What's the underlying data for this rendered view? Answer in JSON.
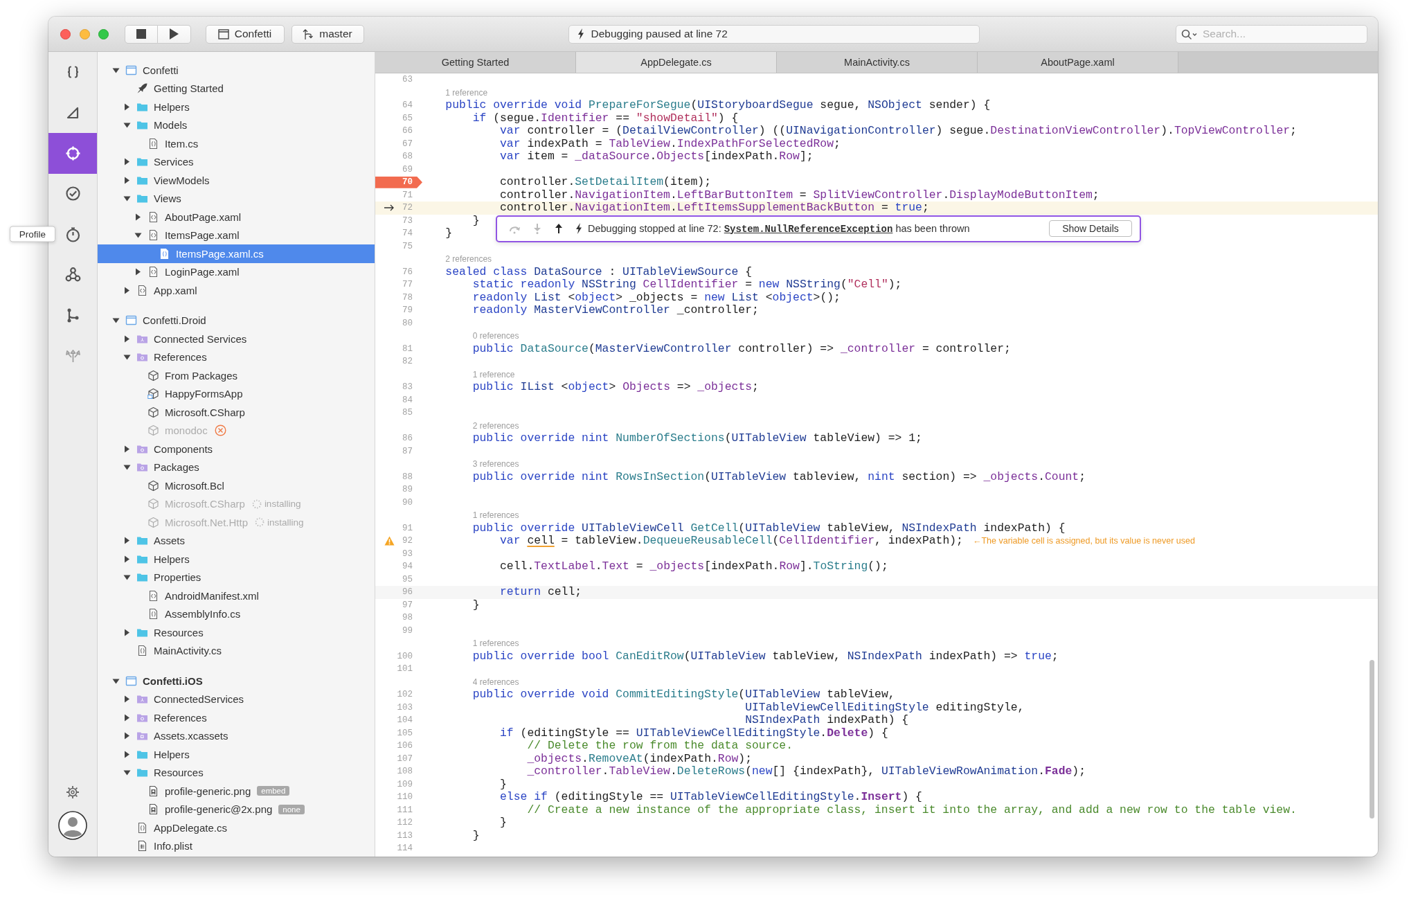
{
  "toolbar": {
    "scheme": "Confetti",
    "branch": "master",
    "status": "Debugging paused at line 72",
    "search": {
      "placeholder": "Search..."
    }
  },
  "activity_bar": {
    "items": [
      {
        "kind": "code",
        "selected": false,
        "disabled": false
      },
      {
        "kind": "design",
        "selected": false,
        "disabled": false
      },
      {
        "kind": "debug",
        "selected": true,
        "disabled": false
      },
      {
        "kind": "test",
        "selected": false,
        "disabled": false
      },
      {
        "kind": "profile",
        "selected": false,
        "disabled": false,
        "tooltip": "Profile"
      },
      {
        "kind": "graph",
        "selected": false,
        "disabled": false
      },
      {
        "kind": "branch",
        "selected": false,
        "disabled": false
      },
      {
        "kind": "deploy",
        "selected": false,
        "disabled": true
      }
    ]
  },
  "tree": [
    {
      "label": "Confetti",
      "kind": "project",
      "expanded": true,
      "selected": false,
      "children": [
        {
          "label": "Getting Started",
          "kind": "rocket",
          "selected": false
        },
        {
          "label": "Helpers",
          "kind": "folder",
          "expanded": false,
          "selected": false
        },
        {
          "label": "Models",
          "kind": "folder",
          "expanded": true,
          "selected": false,
          "children": [
            {
              "label": "Item.cs",
              "kind": "cs",
              "selected": false
            }
          ]
        },
        {
          "label": "Services",
          "kind": "folder",
          "expanded": false,
          "selected": false
        },
        {
          "label": "ViewModels",
          "kind": "folder",
          "expanded": false,
          "selected": false
        },
        {
          "label": "Views",
          "kind": "folder",
          "expanded": true,
          "selected": false,
          "children": [
            {
              "label": "AboutPage.xaml",
              "kind": "xaml",
              "expanded": false,
              "selected": false
            },
            {
              "label": "ItemsPage.xaml",
              "kind": "xaml",
              "expanded": true,
              "selected": false,
              "children": [
                {
                  "label": "ItemsPage.xaml.cs",
                  "kind": "cs",
                  "selected": true
                }
              ]
            },
            {
              "label": "LoginPage.xaml",
              "kind": "xaml",
              "expanded": false,
              "selected": false
            }
          ]
        },
        {
          "label": "App.xaml",
          "kind": "xaml",
          "expanded": false,
          "selected": false
        }
      ]
    },
    {
      "label": "Confetti.Droid",
      "kind": "project",
      "expanded": true,
      "selected": false,
      "children": [
        {
          "label": "Connected Services",
          "kind": "service-folder",
          "expanded": false,
          "selected": false
        },
        {
          "label": "References",
          "kind": "ref-folder",
          "expanded": true,
          "selected": false,
          "children": [
            {
              "label": "From Packages",
              "kind": "package",
              "selected": false
            },
            {
              "label": "HappyFormsApp",
              "kind": "package-app",
              "selected": false
            },
            {
              "label": "Microsoft.CSharp",
              "kind": "package",
              "selected": false
            },
            {
              "label": "monodoc",
              "kind": "package",
              "selected": false,
              "dimmed": true,
              "error": true
            }
          ]
        },
        {
          "label": "Components",
          "kind": "ref-folder",
          "expanded": false,
          "selected": false
        },
        {
          "label": "Packages",
          "kind": "ref-folder",
          "expanded": true,
          "selected": false,
          "children": [
            {
              "label": "Microsoft.Bcl",
              "kind": "package",
              "selected": false
            },
            {
              "label": "Microsoft.CSharp",
              "kind": "package",
              "selected": false,
              "dimmed": true,
              "status": "installing"
            },
            {
              "label": "Microsoft.Net.Http",
              "kind": "package",
              "selected": false,
              "dimmed": true,
              "status": "installing"
            }
          ]
        },
        {
          "label": "Assets",
          "kind": "folder",
          "expanded": false,
          "selected": false
        },
        {
          "label": "Helpers",
          "kind": "folder",
          "expanded": false,
          "selected": false
        },
        {
          "label": "Properties",
          "kind": "folder",
          "expanded": true,
          "selected": false,
          "children": [
            {
              "label": "AndroidManifest.xml",
              "kind": "xaml",
              "selected": false
            },
            {
              "label": "AssemblyInfo.cs",
              "kind": "cs",
              "selected": false
            }
          ]
        },
        {
          "label": "Resources",
          "kind": "folder",
          "expanded": false,
          "selected": false
        },
        {
          "label": "MainActivity.cs",
          "kind": "cs",
          "selected": false
        }
      ]
    },
    {
      "label": "Confetti.iOS",
      "kind": "project",
      "expanded": true,
      "selected": false,
      "startup": true,
      "children": [
        {
          "label": "ConnectedServices",
          "kind": "service-folder",
          "expanded": false,
          "selected": false
        },
        {
          "label": "References",
          "kind": "ref-folder",
          "expanded": false,
          "selected": false
        },
        {
          "label": "Assets.xcassets",
          "kind": "asset-folder",
          "expanded": false,
          "selected": false
        },
        {
          "label": "Helpers",
          "kind": "folder",
          "expanded": false,
          "selected": false
        },
        {
          "label": "Resources",
          "kind": "folder",
          "expanded": true,
          "selected": false,
          "children": [
            {
              "label": "profile-generic.png",
              "kind": "image",
              "selected": false,
              "badge": "embed"
            },
            {
              "label": "profile-generic@2x.png",
              "kind": "image",
              "selected": false,
              "badge": "none"
            }
          ]
        },
        {
          "label": "AppDelegate.cs",
          "kind": "cs",
          "selected": false
        },
        {
          "label": "Info.plist",
          "kind": "plist",
          "selected": false
        }
      ]
    }
  ],
  "editor": {
    "tabs": [
      {
        "label": "Getting Started",
        "selected": false
      },
      {
        "label": "AppDelegate.cs",
        "selected": true
      },
      {
        "label": "MainActivity.cs",
        "selected": false
      },
      {
        "label": "AboutPage.xaml",
        "selected": false
      }
    ],
    "rows": [
      {
        "kind": "line",
        "number": "63"
      },
      {
        "kind": "ref",
        "text": "1 reference"
      },
      {
        "kind": "line",
        "number": "64",
        "code": [
          {
            "kind": "keyword",
            "text": "    public override void "
          },
          {
            "kind": "method",
            "text": "PrepareForSegue"
          },
          {
            "kind": "plain",
            "text": "("
          },
          {
            "kind": "type",
            "text": "UIStoryboardSegue"
          },
          {
            "kind": "plain",
            "text": " segue, "
          },
          {
            "kind": "type",
            "text": "NSObject"
          },
          {
            "kind": "plain",
            "text": " sender) {"
          }
        ]
      },
      {
        "kind": "line",
        "number": "65",
        "code": [
          {
            "kind": "keyword",
            "text": "        if"
          },
          {
            "kind": "plain",
            "text": " (segue."
          },
          {
            "kind": "member",
            "text": "Identifier"
          },
          {
            "kind": "plain",
            "text": " == "
          },
          {
            "kind": "string",
            "text": "\"showDetail\""
          },
          {
            "kind": "plain",
            "text": ") {"
          }
        ]
      },
      {
        "kind": "line",
        "number": "66",
        "code": [
          {
            "kind": "keyword",
            "text": "            var"
          },
          {
            "kind": "plain",
            "text": " controller = ("
          },
          {
            "kind": "type",
            "text": "DetailViewController"
          },
          {
            "kind": "plain",
            "text": ") (("
          },
          {
            "kind": "type",
            "text": "UINavigationController"
          },
          {
            "kind": "plain",
            "text": ") segue."
          },
          {
            "kind": "member",
            "text": "DestinationViewController"
          },
          {
            "kind": "plain",
            "text": ")."
          },
          {
            "kind": "member",
            "text": "TopViewController"
          },
          {
            "kind": "plain",
            "text": ";"
          }
        ]
      },
      {
        "kind": "line",
        "number": "67",
        "code": [
          {
            "kind": "keyword",
            "text": "            var"
          },
          {
            "kind": "plain",
            "text": " indexPath = "
          },
          {
            "kind": "member",
            "text": "TableView"
          },
          {
            "kind": "plain",
            "text": "."
          },
          {
            "kind": "member",
            "text": "IndexPathForSelectedRow"
          },
          {
            "kind": "plain",
            "text": ";"
          }
        ]
      },
      {
        "kind": "line",
        "number": "68",
        "code": [
          {
            "kind": "keyword",
            "text": "            var"
          },
          {
            "kind": "plain",
            "text": " item = "
          },
          {
            "kind": "member",
            "text": "_dataSource"
          },
          {
            "kind": "plain",
            "text": "."
          },
          {
            "kind": "member",
            "text": "Objects"
          },
          {
            "kind": "plain",
            "text": "[indexPath."
          },
          {
            "kind": "member",
            "text": "Row"
          },
          {
            "kind": "plain",
            "text": "];"
          }
        ]
      },
      {
        "kind": "line",
        "number": "69"
      },
      {
        "kind": "breakpoint",
        "number": "70",
        "code": [
          {
            "kind": "plain",
            "text": "            controller."
          },
          {
            "kind": "method",
            "text": "SetDetailItem"
          },
          {
            "kind": "plain",
            "text": "(item);"
          }
        ]
      },
      {
        "kind": "line",
        "number": "71",
        "code": [
          {
            "kind": "plain",
            "text": "            controller."
          },
          {
            "kind": "member",
            "text": "NavigationItem"
          },
          {
            "kind": "plain",
            "text": "."
          },
          {
            "kind": "member",
            "text": "LeftBarButtonItem"
          },
          {
            "kind": "plain",
            "text": " = "
          },
          {
            "kind": "member",
            "text": "SplitViewController"
          },
          {
            "kind": "plain",
            "text": "."
          },
          {
            "kind": "member",
            "text": "DisplayModeButtonItem"
          },
          {
            "kind": "plain",
            "text": ";"
          }
        ]
      },
      {
        "kind": "paused",
        "number": "72",
        "code": [
          {
            "kind": "plain",
            "text": "            controller."
          },
          {
            "kind": "member",
            "text": "NavigationItem"
          },
          {
            "kind": "plain",
            "text": "."
          },
          {
            "kind": "member",
            "text": "LeftItemsSupplementBackButton"
          },
          {
            "kind": "plain",
            "text": " = "
          },
          {
            "kind": "keyword",
            "text": "true"
          },
          {
            "kind": "plain",
            "text": ";"
          }
        ]
      },
      {
        "kind": "line",
        "number": "73",
        "code": [
          {
            "kind": "plain",
            "text": "        }"
          }
        ]
      },
      {
        "kind": "line",
        "number": "74",
        "code": [
          {
            "kind": "plain",
            "text": "    }"
          }
        ]
      },
      {
        "kind": "line",
        "number": "75"
      },
      {
        "kind": "ref",
        "text": "2 references"
      },
      {
        "kind": "line",
        "number": "76",
        "code": [
          {
            "kind": "keyword",
            "text": "    sealed class "
          },
          {
            "kind": "type",
            "text": "DataSource"
          },
          {
            "kind": "plain",
            "text": " : "
          },
          {
            "kind": "type",
            "text": "UITableViewSource"
          },
          {
            "kind": "plain",
            "text": " {"
          }
        ]
      },
      {
        "kind": "line",
        "number": "77",
        "code": [
          {
            "kind": "keyword",
            "text": "        static readonly "
          },
          {
            "kind": "type",
            "text": "NSString"
          },
          {
            "kind": "member",
            "text": " CellIdentifier"
          },
          {
            "kind": "plain",
            "text": " = "
          },
          {
            "kind": "keyword",
            "text": "new "
          },
          {
            "kind": "type",
            "text": "NSString"
          },
          {
            "kind": "plain",
            "text": "("
          },
          {
            "kind": "string",
            "text": "\"Cell\""
          },
          {
            "kind": "plain",
            "text": ");"
          }
        ]
      },
      {
        "kind": "line",
        "number": "78",
        "code": [
          {
            "kind": "keyword",
            "text": "        readonly "
          },
          {
            "kind": "type",
            "text": "List "
          },
          {
            "kind": "plain",
            "text": "<"
          },
          {
            "kind": "keyword",
            "text": "object"
          },
          {
            "kind": "plain",
            "text": "> _objects = "
          },
          {
            "kind": "keyword",
            "text": "new "
          },
          {
            "kind": "type",
            "text": "List "
          },
          {
            "kind": "plain",
            "text": "<"
          },
          {
            "kind": "keyword",
            "text": "object"
          },
          {
            "kind": "plain",
            "text": ">();"
          }
        ]
      },
      {
        "kind": "line",
        "number": "79",
        "code": [
          {
            "kind": "keyword",
            "text": "        readonly "
          },
          {
            "kind": "type",
            "text": "MasterViewController"
          },
          {
            "kind": "plain",
            "text": " _controller;"
          }
        ]
      },
      {
        "kind": "line",
        "number": "80"
      },
      {
        "kind": "ref",
        "text": "0 references"
      },
      {
        "kind": "line",
        "number": "81",
        "code": [
          {
            "kind": "keyword",
            "text": "        public "
          },
          {
            "kind": "method",
            "text": "DataSource"
          },
          {
            "kind": "plain",
            "text": "("
          },
          {
            "kind": "type",
            "text": "MasterViewController"
          },
          {
            "kind": "plain",
            "text": " controller) => "
          },
          {
            "kind": "member",
            "text": "_controller"
          },
          {
            "kind": "plain",
            "text": " = controller;"
          }
        ]
      },
      {
        "kind": "line",
        "number": "82"
      },
      {
        "kind": "ref",
        "text": "1 reference"
      },
      {
        "kind": "line",
        "number": "83",
        "code": [
          {
            "kind": "keyword",
            "text": "        public "
          },
          {
            "kind": "type",
            "text": "IList "
          },
          {
            "kind": "plain",
            "text": "<"
          },
          {
            "kind": "keyword",
            "text": "object"
          },
          {
            "kind": "plain",
            "text": "> "
          },
          {
            "kind": "member",
            "text": "Objects"
          },
          {
            "kind": "plain",
            "text": " => "
          },
          {
            "kind": "member",
            "text": "_objects"
          },
          {
            "kind": "plain",
            "text": ";"
          }
        ]
      },
      {
        "kind": "line",
        "number": "84"
      },
      {
        "kind": "line",
        "number": "85"
      },
      {
        "kind": "ref",
        "text": "2 references"
      },
      {
        "kind": "line",
        "number": "86",
        "code": [
          {
            "kind": "keyword",
            "text": "        public override nint "
          },
          {
            "kind": "method",
            "text": "NumberOfSections"
          },
          {
            "kind": "plain",
            "text": "("
          },
          {
            "kind": "type",
            "text": "UITableView"
          },
          {
            "kind": "plain",
            "text": " tableView) => 1;"
          }
        ]
      },
      {
        "kind": "line",
        "number": "87"
      },
      {
        "kind": "ref",
        "text": "3 references"
      },
      {
        "kind": "line",
        "number": "88",
        "code": [
          {
            "kind": "keyword",
            "text": "        public override nint "
          },
          {
            "kind": "method",
            "text": "RowsInSection"
          },
          {
            "kind": "plain",
            "text": "("
          },
          {
            "kind": "type",
            "text": "UITableView"
          },
          {
            "kind": "plain",
            "text": " tableview, "
          },
          {
            "kind": "keyword",
            "text": "nint"
          },
          {
            "kind": "plain",
            "text": " section) => "
          },
          {
            "kind": "member",
            "text": "_objects"
          },
          {
            "kind": "plain",
            "text": "."
          },
          {
            "kind": "member",
            "text": "Count"
          },
          {
            "kind": "plain",
            "text": ";"
          }
        ]
      },
      {
        "kind": "line",
        "number": "89"
      },
      {
        "kind": "line",
        "number": "90"
      },
      {
        "kind": "ref",
        "text": "1 references"
      },
      {
        "kind": "line",
        "number": "91",
        "code": [
          {
            "kind": "keyword",
            "text": "        public override "
          },
          {
            "kind": "type",
            "text": "UITableViewCell"
          },
          {
            "kind": "method",
            "text": " GetCell"
          },
          {
            "kind": "plain",
            "text": "("
          },
          {
            "kind": "type",
            "text": "UITableView"
          },
          {
            "kind": "plain",
            "text": " tableView, "
          },
          {
            "kind": "type",
            "text": "NSIndexPath"
          },
          {
            "kind": "plain",
            "text": " indexPath) {"
          }
        ]
      },
      {
        "kind": "warning",
        "number": "92",
        "note": "←The variable cell is assigned, but its value is never used",
        "code": [
          {
            "kind": "keyword",
            "text": "            var "
          },
          {
            "kind": "flagged",
            "text": "cell"
          },
          {
            "kind": "plain",
            "text": " = tableView."
          },
          {
            "kind": "method",
            "text": "DequeueReusableCell"
          },
          {
            "kind": "plain",
            "text": "("
          },
          {
            "kind": "member",
            "text": "CellIdentifier"
          },
          {
            "kind": "plain",
            "text": ", indexPath);"
          }
        ]
      },
      {
        "kind": "line",
        "number": "93"
      },
      {
        "kind": "line",
        "number": "94",
        "code": [
          {
            "kind": "plain",
            "text": "            cell."
          },
          {
            "kind": "member",
            "text": "TextLabel"
          },
          {
            "kind": "plain",
            "text": "."
          },
          {
            "kind": "member",
            "text": "Text"
          },
          {
            "kind": "plain",
            "text": " = "
          },
          {
            "kind": "member",
            "text": "_objects"
          },
          {
            "kind": "plain",
            "text": "[indexPath."
          },
          {
            "kind": "member",
            "text": "Row"
          },
          {
            "kind": "plain",
            "text": "]."
          },
          {
            "kind": "method",
            "text": "ToString"
          },
          {
            "kind": "plain",
            "text": "();"
          }
        ]
      },
      {
        "kind": "line",
        "number": "95"
      },
      {
        "kind": "cursor",
        "number": "96",
        "code": [
          {
            "kind": "keyword",
            "text": "            return"
          },
          {
            "kind": "plain",
            "text": " cell;"
          }
        ]
      },
      {
        "kind": "line",
        "number": "97",
        "code": [
          {
            "kind": "plain",
            "text": "        }"
          }
        ]
      },
      {
        "kind": "line",
        "number": "98"
      },
      {
        "kind": "line",
        "number": "99"
      },
      {
        "kind": "ref",
        "text": "1 references"
      },
      {
        "kind": "line",
        "number": "100",
        "code": [
          {
            "kind": "keyword",
            "text": "        public override bool "
          },
          {
            "kind": "method",
            "text": "CanEditRow"
          },
          {
            "kind": "plain",
            "text": "("
          },
          {
            "kind": "type",
            "text": "UITableView"
          },
          {
            "kind": "plain",
            "text": " tableView, "
          },
          {
            "kind": "type",
            "text": "NSIndexPath"
          },
          {
            "kind": "plain",
            "text": " indexPath) => "
          },
          {
            "kind": "keyword",
            "text": "true"
          },
          {
            "kind": "plain",
            "text": ";"
          }
        ]
      },
      {
        "kind": "line",
        "number": "101"
      },
      {
        "kind": "ref",
        "text": "4 references"
      },
      {
        "kind": "line",
        "number": "102",
        "code": [
          {
            "kind": "keyword",
            "text": "        public override void "
          },
          {
            "kind": "method",
            "text": "CommitEditingStyle"
          },
          {
            "kind": "plain",
            "text": "("
          },
          {
            "kind": "type",
            "text": "UITableView"
          },
          {
            "kind": "plain",
            "text": " tableView,"
          }
        ]
      },
      {
        "kind": "line",
        "number": "103",
        "code": [
          {
            "kind": "type",
            "text": "                                                UITableViewCellEditingStyle"
          },
          {
            "kind": "plain",
            "text": " editingStyle,"
          }
        ]
      },
      {
        "kind": "line",
        "number": "104",
        "code": [
          {
            "kind": "type",
            "text": "                                                NSIndexPath"
          },
          {
            "kind": "plain",
            "text": " indexPath) {"
          }
        ]
      },
      {
        "kind": "line",
        "number": "105",
        "code": [
          {
            "kind": "keyword",
            "text": "            if"
          },
          {
            "kind": "plain",
            "text": " (editingStyle == "
          },
          {
            "kind": "type",
            "text": "UITableViewCellEditingStyle"
          },
          {
            "kind": "plain",
            "text": "."
          },
          {
            "kind": "constant",
            "text": "Delete"
          },
          {
            "kind": "plain",
            "text": ") {"
          }
        ]
      },
      {
        "kind": "line",
        "number": "106",
        "code": [
          {
            "kind": "comment",
            "text": "                // Delete the row from the data source."
          }
        ]
      },
      {
        "kind": "line",
        "number": "107",
        "code": [
          {
            "kind": "member",
            "text": "                _objects"
          },
          {
            "kind": "plain",
            "text": "."
          },
          {
            "kind": "method",
            "text": "RemoveAt"
          },
          {
            "kind": "plain",
            "text": "(indexPath."
          },
          {
            "kind": "member",
            "text": "Row"
          },
          {
            "kind": "plain",
            "text": ");"
          }
        ]
      },
      {
        "kind": "line",
        "number": "108",
        "code": [
          {
            "kind": "member",
            "text": "                _controller"
          },
          {
            "kind": "plain",
            "text": "."
          },
          {
            "kind": "member",
            "text": "TableView"
          },
          {
            "kind": "plain",
            "text": "."
          },
          {
            "kind": "method",
            "text": "DeleteRows"
          },
          {
            "kind": "plain",
            "text": "("
          },
          {
            "kind": "keyword",
            "text": "new"
          },
          {
            "kind": "plain",
            "text": "[] {indexPath}, "
          },
          {
            "kind": "type",
            "text": "UITableViewRowAnimation"
          },
          {
            "kind": "plain",
            "text": "."
          },
          {
            "kind": "constant",
            "text": "Fade"
          },
          {
            "kind": "plain",
            "text": ");"
          }
        ]
      },
      {
        "kind": "line",
        "number": "109",
        "code": [
          {
            "kind": "plain",
            "text": "            }"
          }
        ]
      },
      {
        "kind": "line",
        "number": "110",
        "code": [
          {
            "kind": "keyword",
            "text": "            else if"
          },
          {
            "kind": "plain",
            "text": " (editingStyle == "
          },
          {
            "kind": "type",
            "text": "UITableViewCellEditingStyle"
          },
          {
            "kind": "plain",
            "text": "."
          },
          {
            "kind": "constant",
            "text": "Insert"
          },
          {
            "kind": "plain",
            "text": ") {"
          }
        ]
      },
      {
        "kind": "line",
        "number": "111",
        "code": [
          {
            "kind": "comment",
            "text": "                // Create a new instance of the appropriate class, insert it into the array, and add a new row to the table view."
          }
        ]
      },
      {
        "kind": "line",
        "number": "112",
        "code": [
          {
            "kind": "plain",
            "text": "            }"
          }
        ]
      },
      {
        "kind": "line",
        "number": "113",
        "code": [
          {
            "kind": "plain",
            "text": "        }"
          }
        ]
      },
      {
        "kind": "line",
        "number": "114"
      }
    ],
    "debug_popup": {
      "message": "Debugging stopped at line 72:",
      "exception": "System.NullReferenceException",
      "message_end": "has been thrown",
      "button": "Show Details"
    }
  }
}
